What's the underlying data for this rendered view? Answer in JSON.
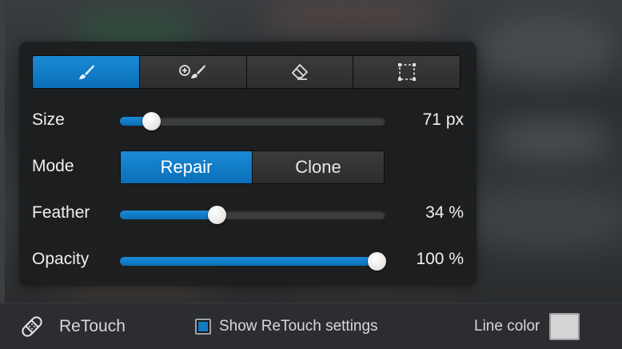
{
  "tools": [
    {
      "name": "brush",
      "icon": "brush-icon",
      "active": true
    },
    {
      "name": "add-brush",
      "icon": "add-brush-icon",
      "active": false
    },
    {
      "name": "eraser",
      "icon": "eraser-icon",
      "active": false
    },
    {
      "name": "selection",
      "icon": "selection-rect-icon",
      "active": false
    }
  ],
  "size": {
    "label": "Size",
    "value_text": "71 px",
    "fraction": 0.09
  },
  "mode": {
    "label": "Mode",
    "options": [
      "Repair",
      "Clone"
    ],
    "selected": "Repair"
  },
  "feather": {
    "label": "Feather",
    "value_text": "34 %",
    "fraction": 0.355
  },
  "opacity": {
    "label": "Opacity",
    "value_text": "100 %",
    "fraction": 1.0
  },
  "bottom_bar": {
    "tool_name": "ReTouch",
    "tool_icon": "bandage-icon",
    "show_settings_label": "Show ReTouch settings",
    "show_settings_checked": true,
    "line_color_label": "Line color",
    "line_color": "#d4d4d4"
  },
  "colors": {
    "accent": "#1679c2"
  }
}
